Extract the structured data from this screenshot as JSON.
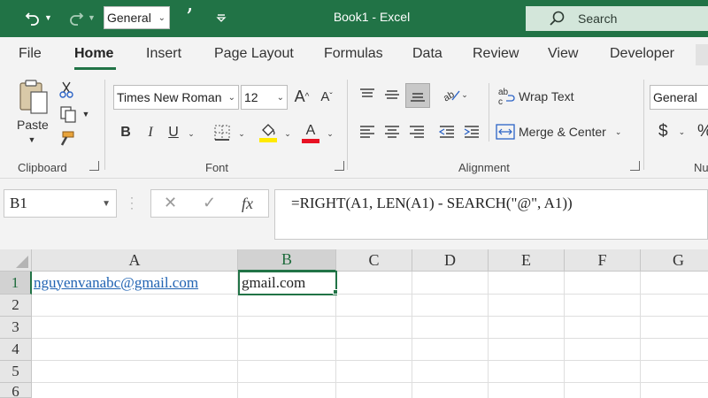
{
  "titlebar": {
    "number_format": "General",
    "title": "Book1  -  Excel",
    "search_label": "Search",
    "bg_color": "#217346"
  },
  "tabs": [
    "File",
    "Home",
    "Insert",
    "Page Layout",
    "Formulas",
    "Data",
    "Review",
    "View",
    "Developer"
  ],
  "ribbon": {
    "clipboard": {
      "paste_label": "Paste",
      "group_label": "Clipboard"
    },
    "font": {
      "font_name": "Times New Roman",
      "font_size": "12",
      "bold": "B",
      "italic": "I",
      "underline": "U",
      "font_color_glyph": "A",
      "group_label": "Font",
      "fill_color": "#ffea00",
      "font_color": "#e81123"
    },
    "alignment": {
      "wrap_text": "Wrap Text",
      "merge_center": "Merge & Center",
      "group_label": "Alignment"
    },
    "number": {
      "format": "General",
      "currency": "$",
      "percent": "%",
      "group_label": "Nu"
    }
  },
  "formula_bar": {
    "name_box": "B1",
    "fx": "fx",
    "formula": "=RIGHT(A1, LEN(A1) - SEARCH(\"@\", A1))"
  },
  "grid": {
    "columns": [
      "A",
      "B",
      "C",
      "D",
      "E",
      "F",
      "G"
    ],
    "rows": [
      "1",
      "2",
      "3",
      "4",
      "5",
      "6"
    ],
    "cells": {
      "A1": "nguyenvanabc@gmail.com",
      "B1": "gmail.com"
    },
    "selected_cell": "B1"
  }
}
